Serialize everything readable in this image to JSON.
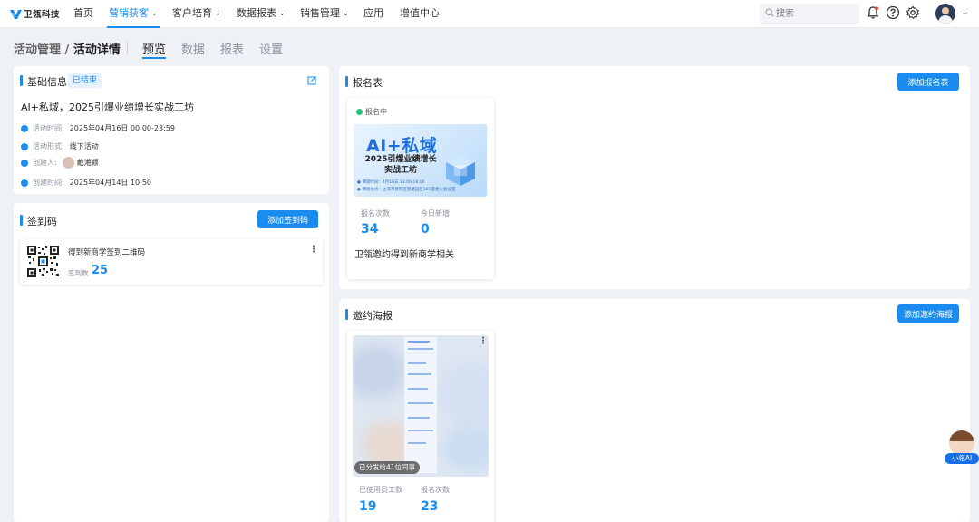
{
  "nav": {
    "logo": "卫瓴科技",
    "items": [
      {
        "label": "首页",
        "dropdown": false,
        "active": false
      },
      {
        "label": "营销获客",
        "dropdown": true,
        "active": true
      },
      {
        "label": "客户培育",
        "dropdown": true,
        "active": false
      },
      {
        "label": "数据报表",
        "dropdown": true,
        "active": false
      },
      {
        "label": "销售管理",
        "dropdown": true,
        "active": false
      },
      {
        "label": "应用",
        "dropdown": false,
        "active": false
      },
      {
        "label": "增值中心",
        "dropdown": false,
        "active": false
      }
    ],
    "search_placeholder": "搜索",
    "icons": [
      "bell-icon",
      "help-icon",
      "gear-icon"
    ]
  },
  "header": {
    "breadcrumb_parent": "活动管理 /",
    "breadcrumb_current": "活动详情",
    "tabs": [
      "预览",
      "数据",
      "报表",
      "设置"
    ],
    "active_tab": "预览"
  },
  "basic": {
    "title": "基础信息",
    "status_badge": "已结束",
    "activity_name": "AI+私域，2025引爆业绩增长实战工坊",
    "rows": [
      {
        "icon": "clock-icon",
        "label": "活动时间:",
        "value": "2025年04月16日 00:00-23:59"
      },
      {
        "icon": "form-icon",
        "label": "活动形式:",
        "value": "线下活动"
      },
      {
        "icon": "user-icon",
        "label": "创建人:",
        "value": "戴湘颖"
      },
      {
        "icon": "clock-icon",
        "label": "创建时间:",
        "value": "2025年04月14日 10:50"
      }
    ]
  },
  "checkin": {
    "title": "签到码",
    "add_button": "添加签到码",
    "code_name": "得到新商学签到二维码",
    "count_label": "签到数",
    "count": "25"
  },
  "form": {
    "title": "报名表",
    "add_button": "添加报名表",
    "status": "报名中",
    "banner_title": "AI+私域",
    "banner_sub1": "2025引爆业绩增长",
    "banner_sub2": "实战工坊",
    "banner_meta1": "● 课程时间：4月16日 13:00-18:00",
    "banner_meta2": "● 课程地点：上海市普陀区智慧园区101室星火会议室",
    "stat1_label": "报名次数",
    "stat1_value": "34",
    "stat2_label": "今日新增",
    "stat2_value": "0",
    "name": "卫瓴邀约得到新商学相关",
    "colors": {
      "accent": "#1a8cf0",
      "live": "#2bc07a"
    }
  },
  "poster": {
    "title": "邀约海报",
    "add_button": "添加邀约海报",
    "share_text": "已分发给41位同事",
    "stat1_label": "已使用员工数",
    "stat1_value": "19",
    "stat2_label": "报名次数",
    "stat2_value": "23"
  },
  "assistant": {
    "label": "小瓴AI"
  }
}
